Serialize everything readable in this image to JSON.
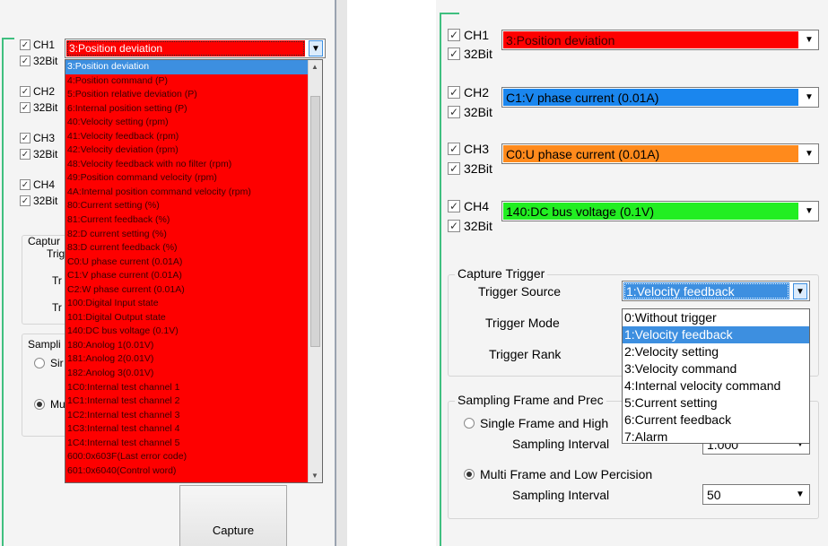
{
  "left": {
    "channels": [
      {
        "ch_label": "CH1",
        "bit_label": "32Bit",
        "value": "3:Position deviation",
        "color": "#fe0000"
      },
      {
        "ch_label": "CH2",
        "bit_label": "32Bit"
      },
      {
        "ch_label": "CH3",
        "bit_label": "32Bit"
      },
      {
        "ch_label": "CH4",
        "bit_label": "32Bit"
      }
    ],
    "dropdown_items": [
      "3:Position deviation",
      "4:Position command (P)",
      "5:Position relative deviation (P)",
      "6:Internal position setting (P)",
      "40:Velocity setting (rpm)",
      "41:Velocity feedback (rpm)",
      "42:Velocity deviation (rpm)",
      "48:Velocity feedback with no filter (rpm)",
      "49:Position command velocity (rpm)",
      "4A:Internal position command velocity (rpm)",
      "80:Current setting (%)",
      "81:Current feedback (%)",
      "82:D current setting (%)",
      "83:D current feedback (%)",
      "C0:U phase current (0.01A)",
      "C1:V phase current (0.01A)",
      "C2:W phase current (0.01A)",
      "100:Digital Input state",
      "101:Digital Output state",
      "140:DC bus voltage (0.1V)",
      "180:Anolog 1(0.01V)",
      "181:Anolog 2(0.01V)",
      "182:Anolog 3(0.01V)",
      "1C0:Internal test channel 1",
      "1C1:Internal test channel 2",
      "1C2:Internal test channel 3",
      "1C3:Internal test channel 4",
      "1C4:Internal test channel 5",
      "600:0x603F(Last error code)",
      "601:0x6040(Control word)"
    ],
    "selected_index": 0,
    "partial_labels": {
      "capture": "Captur",
      "trig": "Trig",
      "tr1": "Tr",
      "tr2": "Tr",
      "sampling": "Sampli",
      "single": "Sir",
      "multi": "Mu"
    },
    "capture_button": "Capture"
  },
  "right": {
    "channels": [
      {
        "ch_label": "CH1",
        "bit_label": "32Bit",
        "value": "3:Position deviation",
        "color": "#fe0000"
      },
      {
        "ch_label": "CH2",
        "bit_label": "32Bit",
        "value": "C1:V phase current (0.01A)",
        "color": "#1a86ee"
      },
      {
        "ch_label": "CH3",
        "bit_label": "32Bit",
        "value": "C0:U phase current (0.01A)",
        "color": "#ff8a1c"
      },
      {
        "ch_label": "CH4",
        "bit_label": "32Bit",
        "value": "140:DC bus voltage (0.1V)",
        "color": "#22ee22"
      }
    ],
    "capture_trigger": {
      "title": "Capture Trigger",
      "source_label": "Trigger Source",
      "source_value": "1:Velocity feedback",
      "mode_label": "Trigger Mode",
      "rank_label": "Trigger Rank",
      "options": [
        "0:Without trigger",
        "1:Velocity feedback",
        "2:Velocity setting",
        "3:Velocity command",
        "4:Internal velocity command",
        "5:Current setting",
        "6:Current feedback",
        "7:Alarm"
      ],
      "selected_index": 1
    },
    "sampling": {
      "title": "Sampling Frame and Prec",
      "single_label": "Single Frame and High",
      "single_interval_label": "Sampling Interval",
      "single_interval_value": "1.000",
      "multi_label": "Multi Frame and Low Percision",
      "multi_interval_label": "Sampling Interval",
      "multi_interval_value": "50"
    }
  }
}
